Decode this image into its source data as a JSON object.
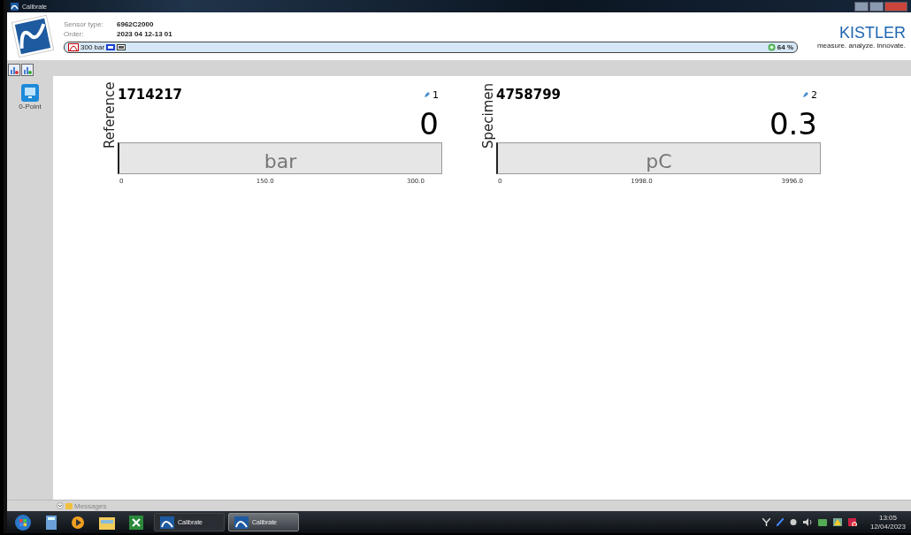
{
  "window": {
    "title": "Calibrate"
  },
  "header": {
    "sensor_type_label": "Sensor type:",
    "sensor_type": "6962C2000",
    "order_label": "Order:",
    "order": "2023 04 12-13 01",
    "range": "300 bar",
    "status": "64 %"
  },
  "brand": {
    "name": "KISTLER",
    "tagline": "measure. analyze. innovate."
  },
  "sidebar": {
    "items": [
      {
        "label": "0-Point"
      }
    ]
  },
  "gauges": [
    {
      "role": "Reference",
      "serial": "1714217",
      "channel": "1",
      "value": "0",
      "unit": "bar",
      "level": 0,
      "ticks": [
        "0",
        "150.0",
        "300.0"
      ]
    },
    {
      "role": "Specimen",
      "serial": "4758799",
      "channel": "2",
      "value": "0.3",
      "unit": "pC",
      "level": 0,
      "ticks": [
        "0",
        "1998.0",
        "3996.0"
      ]
    }
  ],
  "messages": {
    "label": "Messages"
  },
  "taskbar": {
    "buttons": [
      {
        "label": "Calibrate",
        "selected": false
      },
      {
        "label": "Calibrate",
        "selected": true
      }
    ],
    "time": "13:05",
    "date": "12/04/2023"
  }
}
